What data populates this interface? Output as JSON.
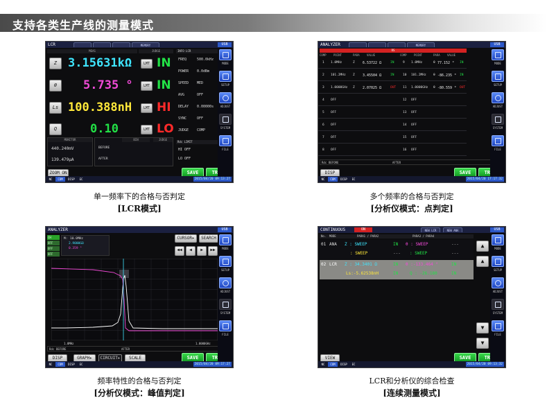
{
  "banner": {
    "title": "支持各类生产线的测量模式"
  },
  "colors": {
    "in": "#22e046",
    "out": "#ff2a2a",
    "blue": "#2c58c9",
    "green_btn": "#1fbf33"
  },
  "screens": {
    "lcr": {
      "title": "LCR",
      "tabs": [
        "",
        "",
        "",
        "MEMORY"
      ],
      "usb": "USB",
      "headers": {
        "meas": "MEAS",
        "judge": "JUDGE",
        "info": "INFO LCR",
        "monitor": "MONITOR",
        "bin": "BIN",
        "judge2": "JUDGE"
      },
      "rows": [
        {
          "btn": "Z",
          "value": "3.15631kΩ",
          "color": "#3fe6ff",
          "lmt": "LMT",
          "judge": "IN",
          "jcolor": "#22e046"
        },
        {
          "btn": "θ",
          "value": "5.735  °",
          "color": "#f24bd8",
          "lmt": "LMT",
          "judge": "IN",
          "jcolor": "#22e046"
        },
        {
          "btn": "Ls",
          "value": "100.388nH",
          "color": "#ffe83a",
          "lmt": "LMT",
          "judge": "HI",
          "jcolor": "#ff2a2a"
        },
        {
          "btn": "Q",
          "value": "0.10",
          "color": "#22e046",
          "lmt": "LMT",
          "judge": "LO",
          "jcolor": "#ff2a2a"
        }
      ],
      "info": [
        {
          "k": "FREQ",
          "v": "500.0kHz"
        },
        {
          "k": "POWER",
          "v": "0.0dBm"
        },
        {
          "k": "SPEED",
          "v": "MED"
        },
        {
          "k": "AVG",
          "v": "OFF"
        },
        {
          "k": "DELAY",
          "v": "0.00000s"
        },
        {
          "k": "SYNC",
          "v": "OFF"
        },
        {
          "k": "JUDGE",
          "v": "COMP"
        }
      ],
      "monitor": [
        "440.240mV",
        "139.479μA"
      ],
      "bin_rows": [
        "BEFORE",
        "AFTER"
      ],
      "rdc": {
        "title": "Rdc LIMIT",
        "hi": "HI  OFF",
        "lo": "LO  OFF"
      },
      "zoom": "ZOOM ON",
      "save": "SAVE",
      "trig": "TRIG",
      "status": [
        "NC",
        "COM",
        "DISP",
        "EC"
      ],
      "datetime": "2015/04/20 09:13:27",
      "side": [
        "MODE",
        "SETUP",
        "ADJUST",
        "SYSTEM",
        "FILE"
      ]
    },
    "point": {
      "title": "ANALYZER",
      "usb": "USB",
      "tabs": [
        "",
        "",
        "",
        "MEMORY"
      ],
      "header_label": "RS",
      "cols": [
        "COMP",
        "POINT",
        "PARA",
        "VALUE",
        "COMP",
        "POINT",
        "PARA",
        "VALUE"
      ],
      "rows": [
        {
          "n": "1",
          "pt": "1.0MHz",
          "pa": "Z",
          "val": "6.53722 Ω",
          "j": "IN",
          "n2": "9",
          "pt2": "1.0MHz",
          "pa2": "θ",
          "val2": "77.152 °",
          "j2": "IN"
        },
        {
          "n": "2",
          "pt": "101.2MHz",
          "pa": "Z",
          "val": "3.45504 Ω",
          "j": "IN",
          "n2": "10",
          "pt2": "101.2MHz",
          "pa2": "θ",
          "val2": "-86.235 °",
          "j2": "IN"
        },
        {
          "n": "3",
          "pt": "1.0000GHz",
          "pa": "Z",
          "val": "2.07025 Ω",
          "j": "OUT",
          "n2": "11",
          "pt2": "1.0000GHz",
          "pa2": "θ",
          "val2": "-80.559 °",
          "j2": "OUT"
        },
        {
          "n": "4",
          "pt": "OFF",
          "n2": "12",
          "pt2": "OFF"
        },
        {
          "n": "5",
          "pt": "OFF",
          "n2": "13",
          "pt2": "OFF"
        },
        {
          "n": "6",
          "pt": "OFF",
          "n2": "14",
          "pt2": "OFF"
        },
        {
          "n": "7",
          "pt": "OFF",
          "n2": "15",
          "pt2": "OFF"
        },
        {
          "n": "8",
          "pt": "OFF",
          "n2": "16",
          "pt2": "OFF"
        }
      ],
      "rdc_row": [
        "Rdc",
        "BEFORE",
        "AFTER"
      ],
      "disp": "DISP",
      "save": "SAVE",
      "trig": "TRIG",
      "status": [
        "NC",
        "COM",
        "DISP",
        "EC"
      ],
      "datetime": "2015/04/20 17:17:32",
      "side": [
        "MODE",
        "SETUP",
        "ADJUST",
        "SYSTEM",
        "FILE"
      ]
    },
    "peak": {
      "title": "ANALYZER",
      "usb": "USB",
      "marker": {
        "label": "M:",
        "freq": "10.0MHz",
        "v1": "2.9000GΩ",
        "v2": "0.359 °"
      },
      "legend": [
        "CH",
        "OFF",
        "OFF",
        "OFF"
      ],
      "cursor": "CURSOR▸",
      "search": "SEARCH",
      "x_start": "1.0MHz",
      "x_end": "1.0000GHz",
      "rdc_row": [
        "Rdc",
        "BEFORE",
        "AFTER"
      ],
      "buttons": [
        "DISP",
        "GRAPH▸",
        "CIRCUIT▸",
        "SCALE"
      ],
      "save": "SAVE",
      "trig": "TRIG",
      "status": [
        "NC",
        "COM",
        "DISP",
        "EC"
      ],
      "datetime": "2015/04/20 09:17:27",
      "side": [
        "MODE",
        "SETUP",
        "ADJUST",
        "SYSTEM",
        "FILE"
      ]
    },
    "continuous": {
      "title": "CONTINUOUS",
      "badge": "ON",
      "usb": "USB",
      "tabs": [
        "NEW LCR",
        "NEW ANA"
      ],
      "cols": [
        "No.",
        "MODE",
        "PARA1 / PARA2",
        "PARA3 / PARA4"
      ],
      "rows": [
        {
          "n": "01",
          "mode": "ANA",
          "p1": "Z : SWEEP",
          "j1": "IN",
          "p3": "θ : SWEEP",
          "j3": "---",
          "p2": ": SWEEP",
          "j2": "---",
          "p4": ": SWEEP",
          "j4": "---"
        },
        {
          "n": "02",
          "mode": "LCR",
          "p1": "Z : 34.3401 Ω",
          "j1": "IN",
          "p3": "θ :-133.464 °",
          "j3": "IN",
          "p2": "Ls:-5.62538nH",
          "j2": "IN",
          "p4": "Q : -26.180",
          "j4": "IN"
        }
      ],
      "view": "VIEW",
      "save": "SAVE",
      "trig": "TRIG",
      "status": [
        "NC",
        "COM",
        "DISP",
        "EC"
      ],
      "datetime": "2015/04/20 09:13:32",
      "side": [
        "MODE",
        "SETUP",
        "ADJUST",
        "SYSTEM",
        "FILE"
      ]
    }
  },
  "captions": [
    {
      "line1": "单一频率下的合格与否判定",
      "line2": "[LCR模式]"
    },
    {
      "line1": "多个频率的合格与否判定",
      "line2": "[分析仪模式：点判定]"
    },
    {
      "line1": "频率特性的合格与否判定",
      "line2": "[分析仪模式：峰值判定]"
    },
    {
      "line1": "LCR和分析仪的综合检查",
      "line2": "[连续测量模式]"
    }
  ]
}
